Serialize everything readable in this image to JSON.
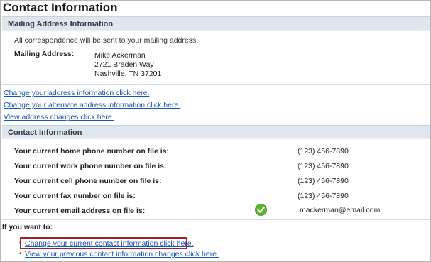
{
  "page": {
    "title": "Contact Information"
  },
  "mailing": {
    "header": "Mailing Address Information",
    "note": "All correspondence will be sent to your mailing address.",
    "label": "Mailing Address:",
    "lines": [
      "Mike Ackerman",
      "2721 Braden Way",
      "Nashville, TN 37201"
    ]
  },
  "address_links": [
    "Change your address information click here.",
    "Change your alternate address information click here.",
    "View address changes click here."
  ],
  "contact": {
    "header": "Contact Information",
    "rows": [
      {
        "label": "Your current home phone number on file is:",
        "value": "(123) 456-7890"
      },
      {
        "label": "Your current work phone number on file is:",
        "value": "(123) 456-7890"
      },
      {
        "label": "Your current cell phone number on file is:",
        "value": "(123) 456-7890"
      },
      {
        "label": "Your current fax number on file is:",
        "value": "(123) 456-7890"
      },
      {
        "label": "Your current email address on file is:",
        "value": "mackerman@email.com",
        "verified_icon": "check-circle-icon"
      }
    ]
  },
  "actions": {
    "intro": "If you want to:",
    "links": [
      "Change your current contact information click here.",
      "View your previous contact information changes click here."
    ],
    "highlight_color": "#a52026"
  },
  "colors": {
    "link": "#1a55b8",
    "section_bg": "#dfe6ee",
    "check": "#5cb531"
  }
}
